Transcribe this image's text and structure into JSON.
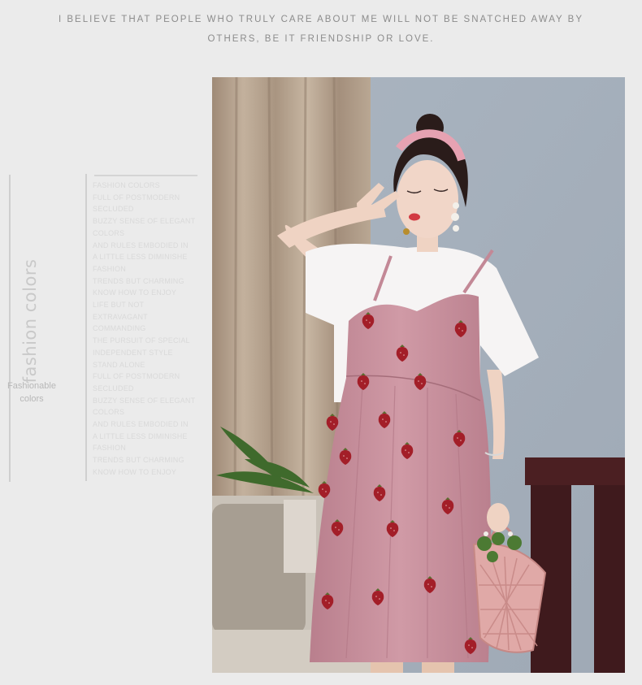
{
  "header": {
    "line1": "I BELIEVE THAT PEOPLE WHO TRULY CARE ABOUT ME WILL NOT BE SNATCHED AWAY BY",
    "line2": "OTHERS, BE IT FRIENDSHIP OR LOVE."
  },
  "side": {
    "vertical_title": "fashion colors",
    "label_line1": "Fashionable",
    "label_line2": "colors"
  },
  "copy_lines": [
    "FASHION COLORS",
    "FULL OF POSTMODERN",
    "SECLUDED",
    "BUZZY SENSE OF ELEGANT",
    "COLORS",
    "AND RULES EMBODIED IN",
    "A LITTLE LESS DIMINISHE",
    "FASHION",
    "TRENDS BUT CHARMING",
    "KNOW HOW TO ENJOY",
    "LIFE BUT NOT",
    "EXTRAVAGANT",
    "COMMANDING",
    "THE PURSUIT OF SPECIAL",
    "INDEPENDENT STYLE",
    "STAND ALONE",
    "FULL OF POSTMODERN",
    "SECLUDED",
    "BUZZY SENSE OF ELEGANT",
    "COLORS",
    "AND RULES EMBODIED IN",
    "A LITTLE LESS DIMINISHE",
    "FASHION",
    "TRENDS BUT CHARMING",
    "KNOW HOW TO ENJOY"
  ],
  "colors": {
    "background": "#ebebeb",
    "dress": "#c98f9c",
    "strawberry": "#a8202a",
    "tshirt": "#f6f4f4",
    "curtain": "#b3a08c",
    "wall": "#a9b3be"
  }
}
